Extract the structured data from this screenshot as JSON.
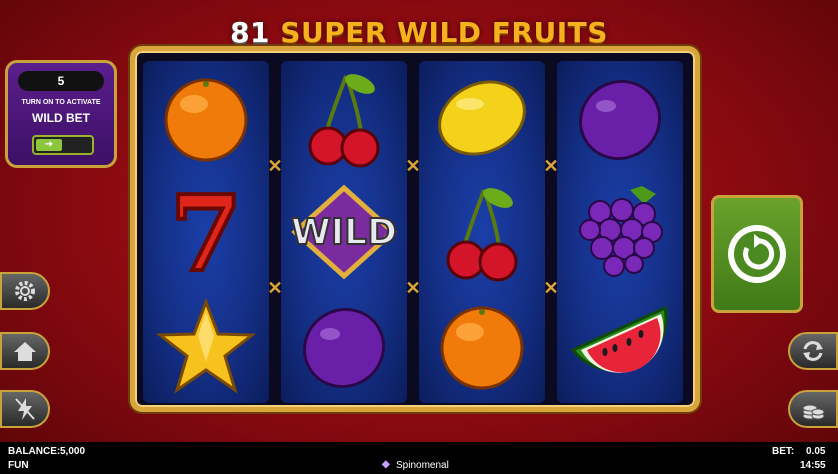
{
  "title": {
    "count": "81",
    "name": "SUPER WILD FRUITS"
  },
  "wild_bet": {
    "count": "5",
    "hint": "TURN ON TO ACTIVATE",
    "label": "WILD BET",
    "toggle_state": "off"
  },
  "reels": [
    [
      "orange",
      "seven",
      "star"
    ],
    [
      "cherries",
      "wild",
      "plum"
    ],
    [
      "lemon",
      "cherries",
      "orange"
    ],
    [
      "plum",
      "grapes",
      "watermelon"
    ]
  ],
  "wild_text": "WILD",
  "seven_text": "7",
  "left_buttons": [
    "gear-icon",
    "home-icon",
    "lightning-icon"
  ],
  "right_buttons": [
    "autoplay-icon",
    "coins-icon"
  ],
  "spin_button": "spin-icon",
  "footer": {
    "balance_label": "BALANCE:",
    "balance_value": "5,000",
    "mode": "FUN",
    "brand": "Spinomenal",
    "bet_label": "BET:",
    "bet_value": "0.05",
    "time": "14:55"
  },
  "colors": {
    "accent_gold": "#d9a53a",
    "reel_blue": "#142f86",
    "spin_green": "#5a962a",
    "background_red": "#9a0e16"
  }
}
